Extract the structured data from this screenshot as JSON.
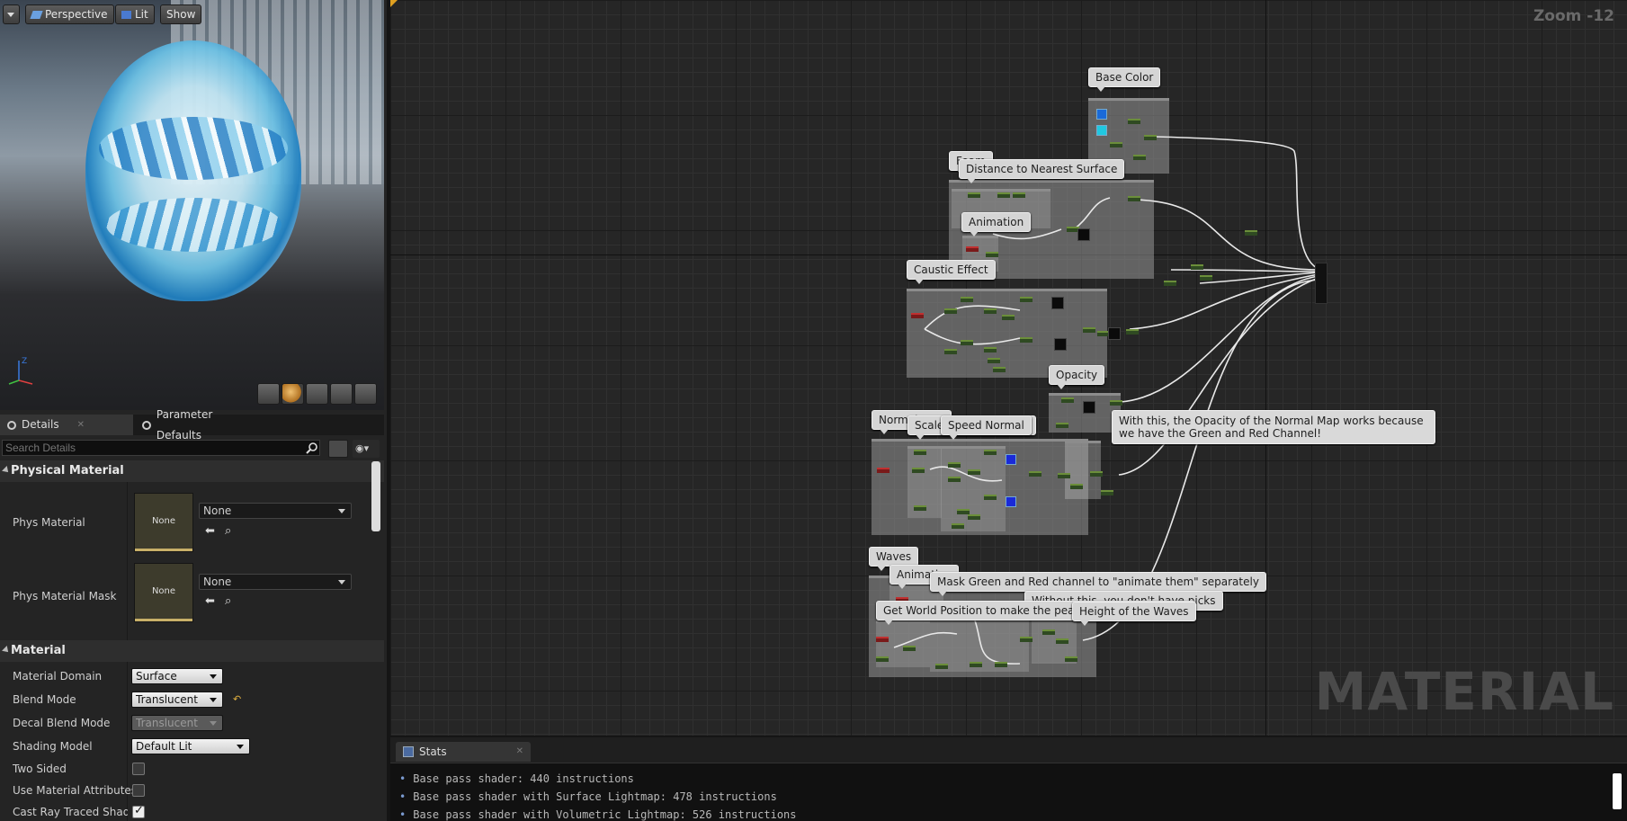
{
  "viewport": {
    "menu_label": "",
    "perspective_label": "Perspective",
    "lit_label": "Lit",
    "show_label": "Show"
  },
  "details_tabs": [
    {
      "label": "Details"
    },
    {
      "label": "Parameter Defaults"
    }
  ],
  "search": {
    "placeholder": "Search Details"
  },
  "physical_material": {
    "category": "Physical Material",
    "phys_material_label": "Phys Material",
    "phys_material_thumb": "None",
    "phys_material_value": "None",
    "phys_material_mask_label": "Phys Material Mask",
    "phys_material_mask_thumb": "None",
    "phys_material_mask_value": "None"
  },
  "material": {
    "category": "Material",
    "rows": [
      {
        "label": "Material Domain",
        "value": "Surface"
      },
      {
        "label": "Blend Mode",
        "value": "Translucent"
      },
      {
        "label": "Decal Blend Mode",
        "value": "Translucent"
      },
      {
        "label": "Shading Model",
        "value": "Default Lit"
      },
      {
        "label": "Two Sided",
        "checked": false
      },
      {
        "label": "Use Material Attributes",
        "checked": false
      },
      {
        "label": "Cast Ray Traced Shadows",
        "checked": true
      }
    ]
  },
  "graph": {
    "zoom_label": "Zoom -12",
    "watermark": "MATERIAL",
    "comments": {
      "base_color": "Base Color",
      "foam": "Foam",
      "distance": "Distance to Nearest Surface",
      "animation_foam": "Animation",
      "caustic": "Caustic Effect",
      "opacity": "Opacity",
      "normal_map": "Normal Map",
      "scale_normal": "Scale Normal Texture",
      "speed_normal": "Speed Normal",
      "waves": "Waves",
      "animation_waves": "Animation",
      "mask_note": "Mask Green and Red channel to \"animate them\" separately",
      "picks_note": "Without this, you don't have picks",
      "height_note": "Height of the Waves",
      "world_pos_note": "Get World Position to make the peak higher of the water",
      "opacity_note": "With this, the Opacity of the Normal Map works because we have the Green and Red Channel!"
    }
  },
  "stats": {
    "tab_label": "Stats",
    "lines": [
      "Base pass shader: 440 instructions",
      "Base pass shader with Surface Lightmap: 478 instructions",
      "Base pass shader with Volumetric Lightmap: 526 instructions"
    ]
  }
}
